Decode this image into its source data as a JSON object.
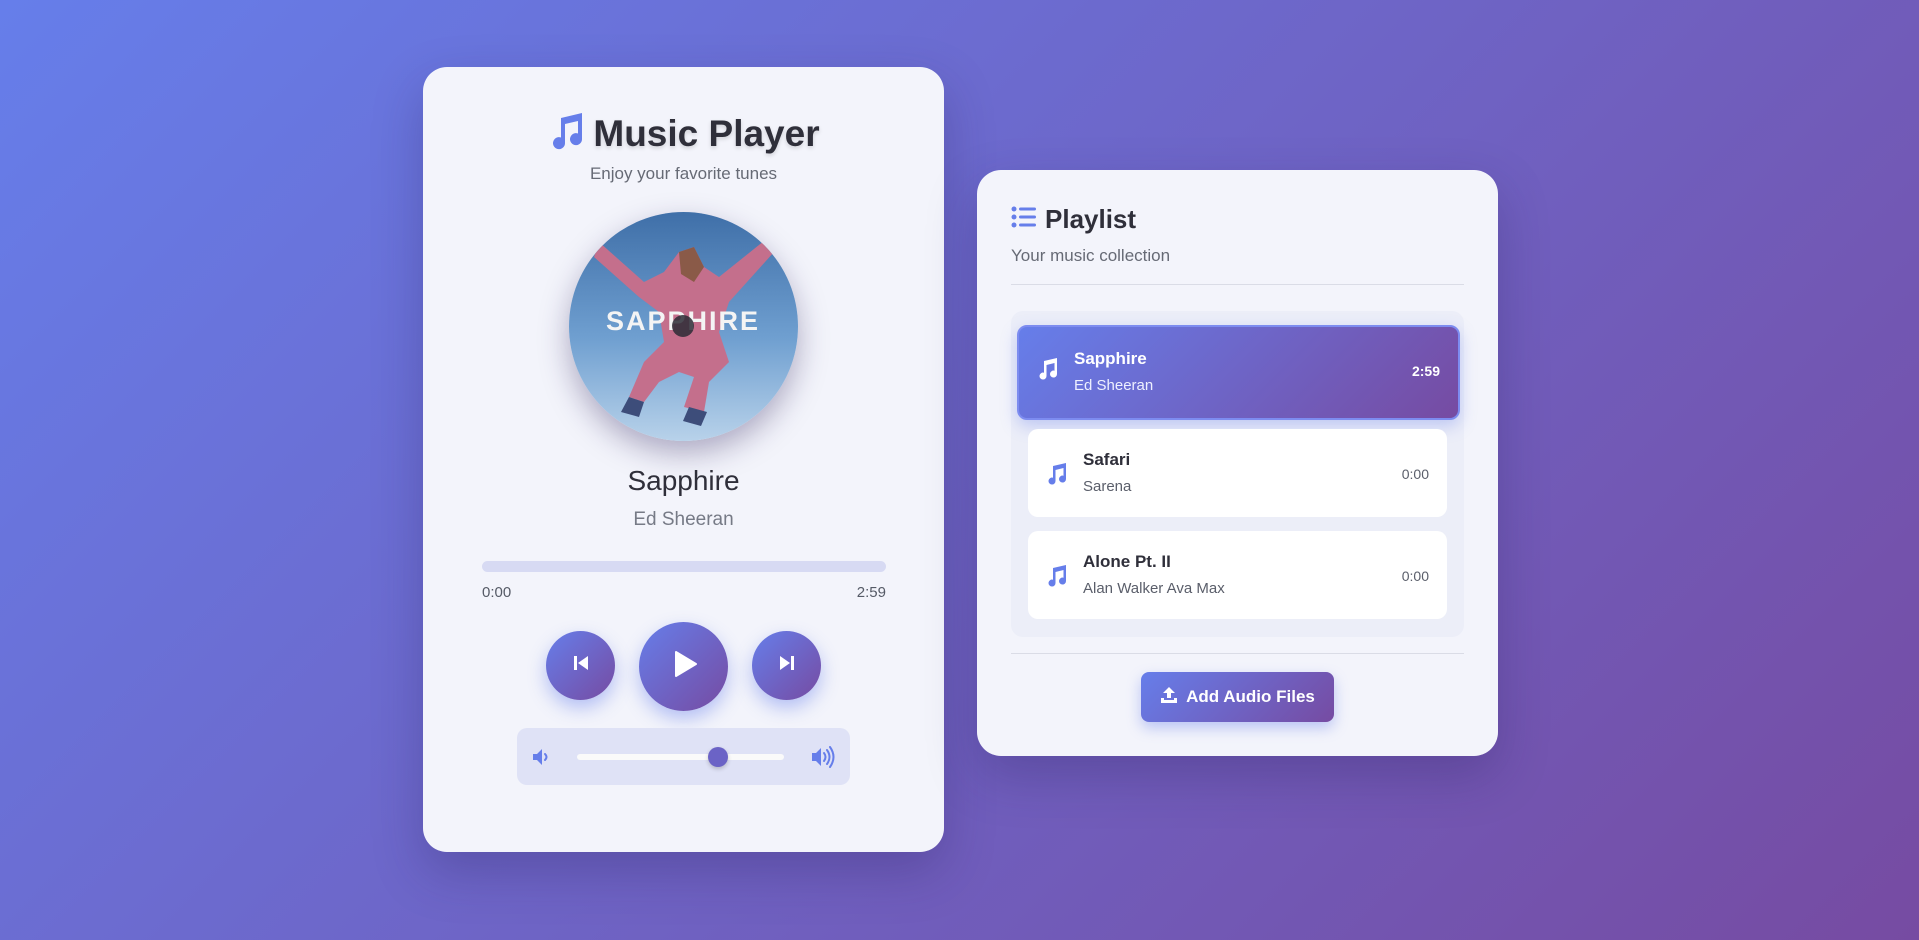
{
  "colors": {
    "accent": "#667eea",
    "accent_dark": "#764ba2",
    "card_bg": "#f3f4fb",
    "text_primary": "#2f2f3a"
  },
  "player": {
    "title": "Music Player",
    "title_icon": "music-note-icon",
    "subtitle": "Enjoy your favorite tunes",
    "album_art_text": "SAPPHIRE",
    "now_playing": {
      "title": "Sapphire",
      "artist": "Ed Sheeran"
    },
    "progress": {
      "current": "0:00",
      "total": "2:59",
      "fraction": 0
    },
    "controls": {
      "prev_icon": "skip-back-icon",
      "play_icon": "play-icon",
      "next_icon": "skip-forward-icon"
    },
    "volume": {
      "low_icon": "volume-low-icon",
      "high_icon": "volume-high-icon",
      "level": 0.68
    }
  },
  "playlist": {
    "title": "Playlist",
    "title_icon": "list-icon",
    "subtitle": "Your music collection",
    "items": [
      {
        "name": "Sapphire",
        "artist": "Ed Sheeran",
        "duration": "2:59",
        "active": true,
        "icon": "music-note-icon"
      },
      {
        "name": "Safari",
        "artist": "Sarena",
        "duration": "0:00",
        "active": false,
        "icon": "music-note-icon"
      },
      {
        "name": "Alone Pt. II",
        "artist": "Alan Walker Ava Max",
        "duration": "0:00",
        "active": false,
        "icon": "music-note-icon"
      }
    ],
    "add_button": {
      "label": "Add Audio Files",
      "icon": "upload-icon"
    }
  }
}
